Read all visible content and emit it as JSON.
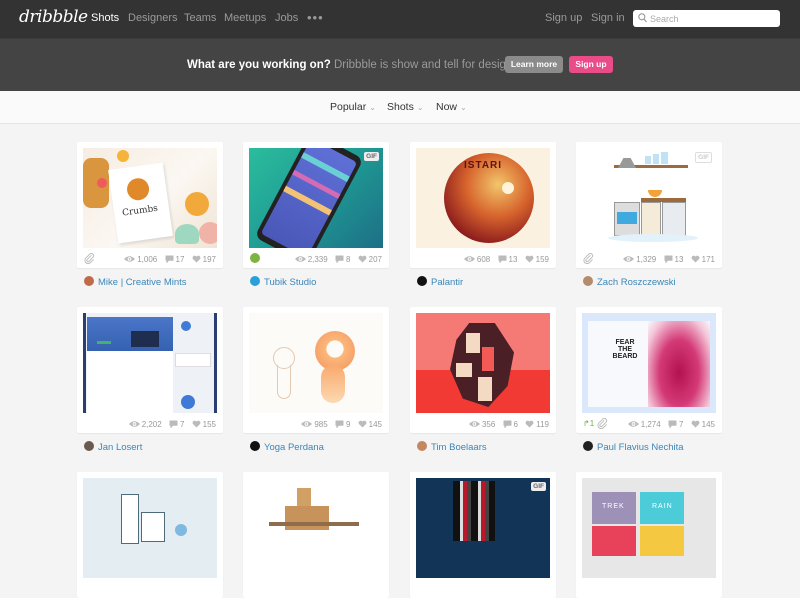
{
  "nav": {
    "logo": "dribbble",
    "items": [
      "Shots",
      "Designers",
      "Teams",
      "Meetups",
      "Jobs"
    ],
    "more": "•••",
    "signup": "Sign up",
    "signin": "Sign in",
    "search_placeholder": "Search",
    "search_value": ""
  },
  "banner": {
    "strong": "What are you working on?",
    "light": " Dribbble is show and tell for designers.",
    "learn_more": "Learn more",
    "signup": "Sign up"
  },
  "filters": {
    "sort": "Popular",
    "type": "Shots",
    "time": "Now",
    "chevron": "⌄"
  },
  "colors": {
    "accent_pink": "#ea4c89",
    "link_blue": "#3a86b8",
    "nav_bg": "#333333"
  },
  "shots": [
    {
      "author": "Mike | Creative Mints",
      "views": "1,006",
      "comments": "17",
      "likes": "197",
      "gif": false,
      "attachment": true,
      "rebound": false,
      "rebounds": ""
    },
    {
      "author": "Tubik Studio",
      "views": "2,339",
      "comments": "8",
      "likes": "207",
      "gif": true,
      "attachment": false,
      "rebound": true,
      "rebounds": ""
    },
    {
      "author": "Palantir",
      "views": "608",
      "comments": "13",
      "likes": "159",
      "gif": false,
      "attachment": false,
      "rebound": false,
      "rebounds": "",
      "image_text": "ISTARI"
    },
    {
      "author": "Zach Roszczewski",
      "views": "1,329",
      "comments": "13",
      "likes": "171",
      "gif": true,
      "attachment": true,
      "rebound": false,
      "rebounds": ""
    },
    {
      "author": "Jan Losert",
      "views": "2,202",
      "comments": "7",
      "likes": "155",
      "gif": false,
      "attachment": false,
      "rebound": false,
      "rebounds": ""
    },
    {
      "author": "Yoga Perdana",
      "views": "985",
      "comments": "9",
      "likes": "145",
      "gif": false,
      "attachment": false,
      "rebound": false,
      "rebounds": ""
    },
    {
      "author": "Tim Boelaars",
      "views": "356",
      "comments": "6",
      "likes": "119",
      "gif": false,
      "attachment": false,
      "rebound": false,
      "rebounds": ""
    },
    {
      "author": "Paul Flavius Nechita",
      "views": "1,274",
      "comments": "7",
      "likes": "145",
      "gif": false,
      "attachment": true,
      "rebound": false,
      "rebounds": "1",
      "image_text": "FEAR THE BEARD"
    },
    {
      "gif": false
    },
    {
      "gif": false
    },
    {
      "gif": true
    },
    {
      "gif": false,
      "image_text": [
        "TREK",
        "RAIN"
      ]
    }
  ],
  "gif_label": "GIF"
}
